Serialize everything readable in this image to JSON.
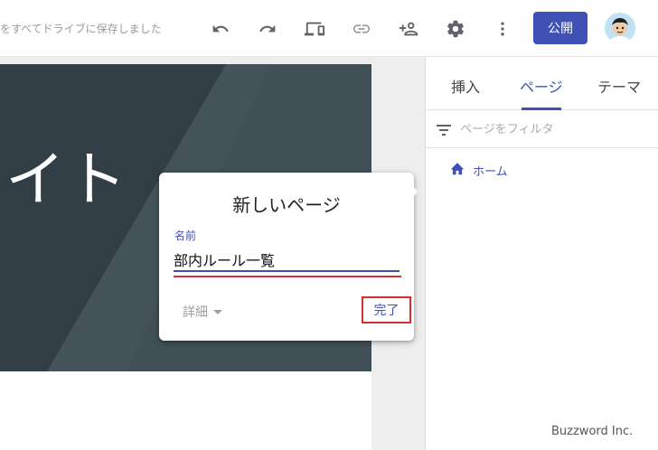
{
  "topbar": {
    "save_status": "をすべてドライブに保存しました",
    "publish_label": "公開",
    "icons": [
      "undo-icon",
      "redo-icon",
      "device-preview-icon",
      "link-icon",
      "add-person-icon",
      "gear-icon",
      "more-vert-icon"
    ]
  },
  "banner": {
    "title_fragment": "イト"
  },
  "right_panel": {
    "tabs": [
      {
        "label": "挿入"
      },
      {
        "label": "ページ"
      },
      {
        "label": "テーマ"
      }
    ],
    "active_tab": "ページ",
    "filter_placeholder": "ページをフィルタ",
    "pages": [
      {
        "label": "ホーム",
        "icon": "home-icon"
      }
    ]
  },
  "dialog": {
    "title": "新しいページ",
    "field_label": "名前",
    "name_value": "部内ルール一覧",
    "details_label": "詳細",
    "done_label": "完了"
  },
  "watermark": "Buzzword Inc.",
  "colors": {
    "accent": "#3f51b5",
    "highlight": "#d32f2f",
    "banner": "#37474f"
  }
}
